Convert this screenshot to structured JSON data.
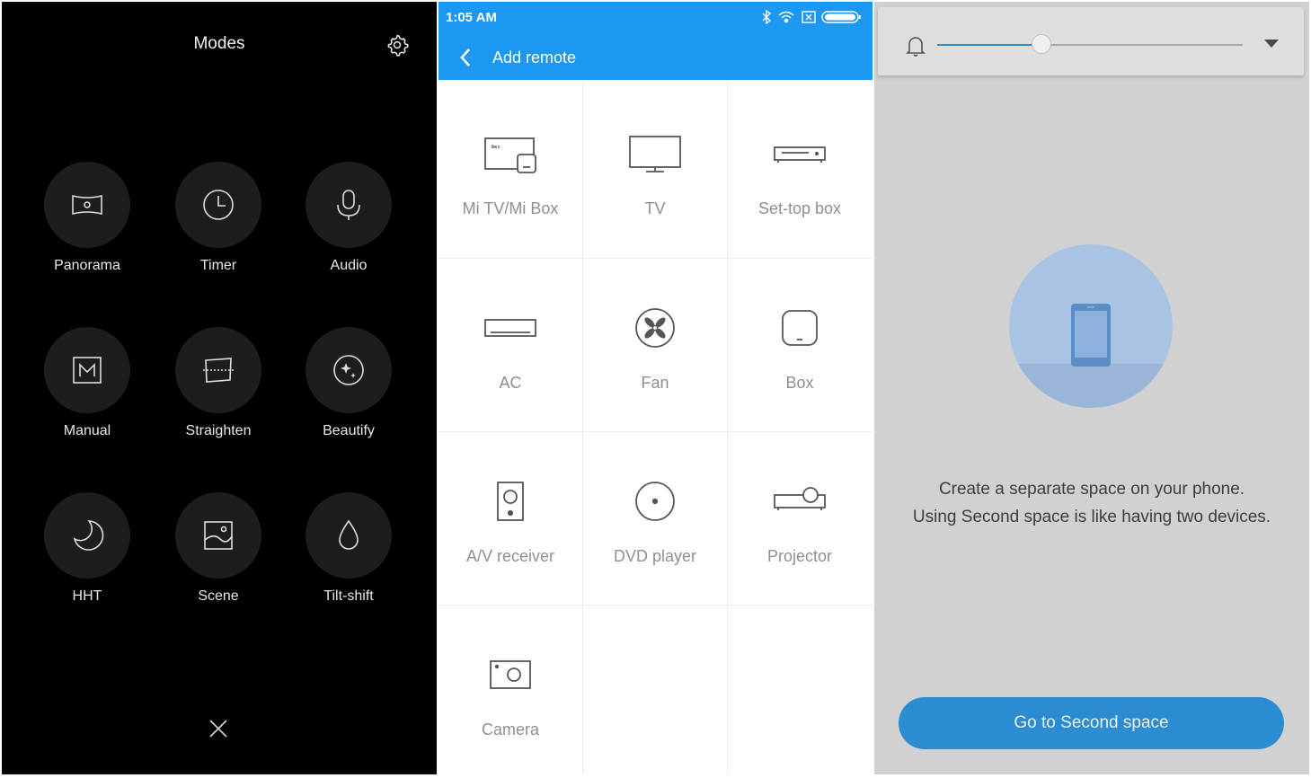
{
  "modes_screen": {
    "title": "Modes",
    "settings_icon": "gear-icon",
    "close_icon": "close-icon",
    "items": [
      {
        "label": "Panorama",
        "icon": "panorama-icon"
      },
      {
        "label": "Timer",
        "icon": "timer-icon"
      },
      {
        "label": "Audio",
        "icon": "microphone-icon"
      },
      {
        "label": "Manual",
        "icon": "manual-icon"
      },
      {
        "label": "Straighten",
        "icon": "straighten-icon"
      },
      {
        "label": "Beautify",
        "icon": "beautify-icon"
      },
      {
        "label": "HHT",
        "icon": "moon-icon"
      },
      {
        "label": "Scene",
        "icon": "scene-icon"
      },
      {
        "label": "Tilt-shift",
        "icon": "drop-icon"
      }
    ]
  },
  "remote_screen": {
    "status_time": "1:05 AM",
    "title": "Add remote",
    "header_color": "#1c97f2",
    "devices": [
      {
        "label": "Mi TV/Mi Box",
        "icon": "mi-tv-icon"
      },
      {
        "label": "TV",
        "icon": "tv-icon"
      },
      {
        "label": "Set-top box",
        "icon": "set-top-box-icon"
      },
      {
        "label": "AC",
        "icon": "ac-icon"
      },
      {
        "label": "Fan",
        "icon": "fan-icon"
      },
      {
        "label": "Box",
        "icon": "box-icon"
      },
      {
        "label": "A/V receiver",
        "icon": "speaker-icon"
      },
      {
        "label": "DVD player",
        "icon": "disc-icon"
      },
      {
        "label": "Projector",
        "icon": "projector-icon"
      },
      {
        "label": "Camera",
        "icon": "camera-icon"
      }
    ]
  },
  "second_space_screen": {
    "volume_level": 0.34,
    "description_line1": "Create a separate space on your phone.",
    "description_line2": "Using Second space is like having two devices.",
    "button_label": "Go to Second space",
    "accent_color": "#2c8cd2"
  }
}
